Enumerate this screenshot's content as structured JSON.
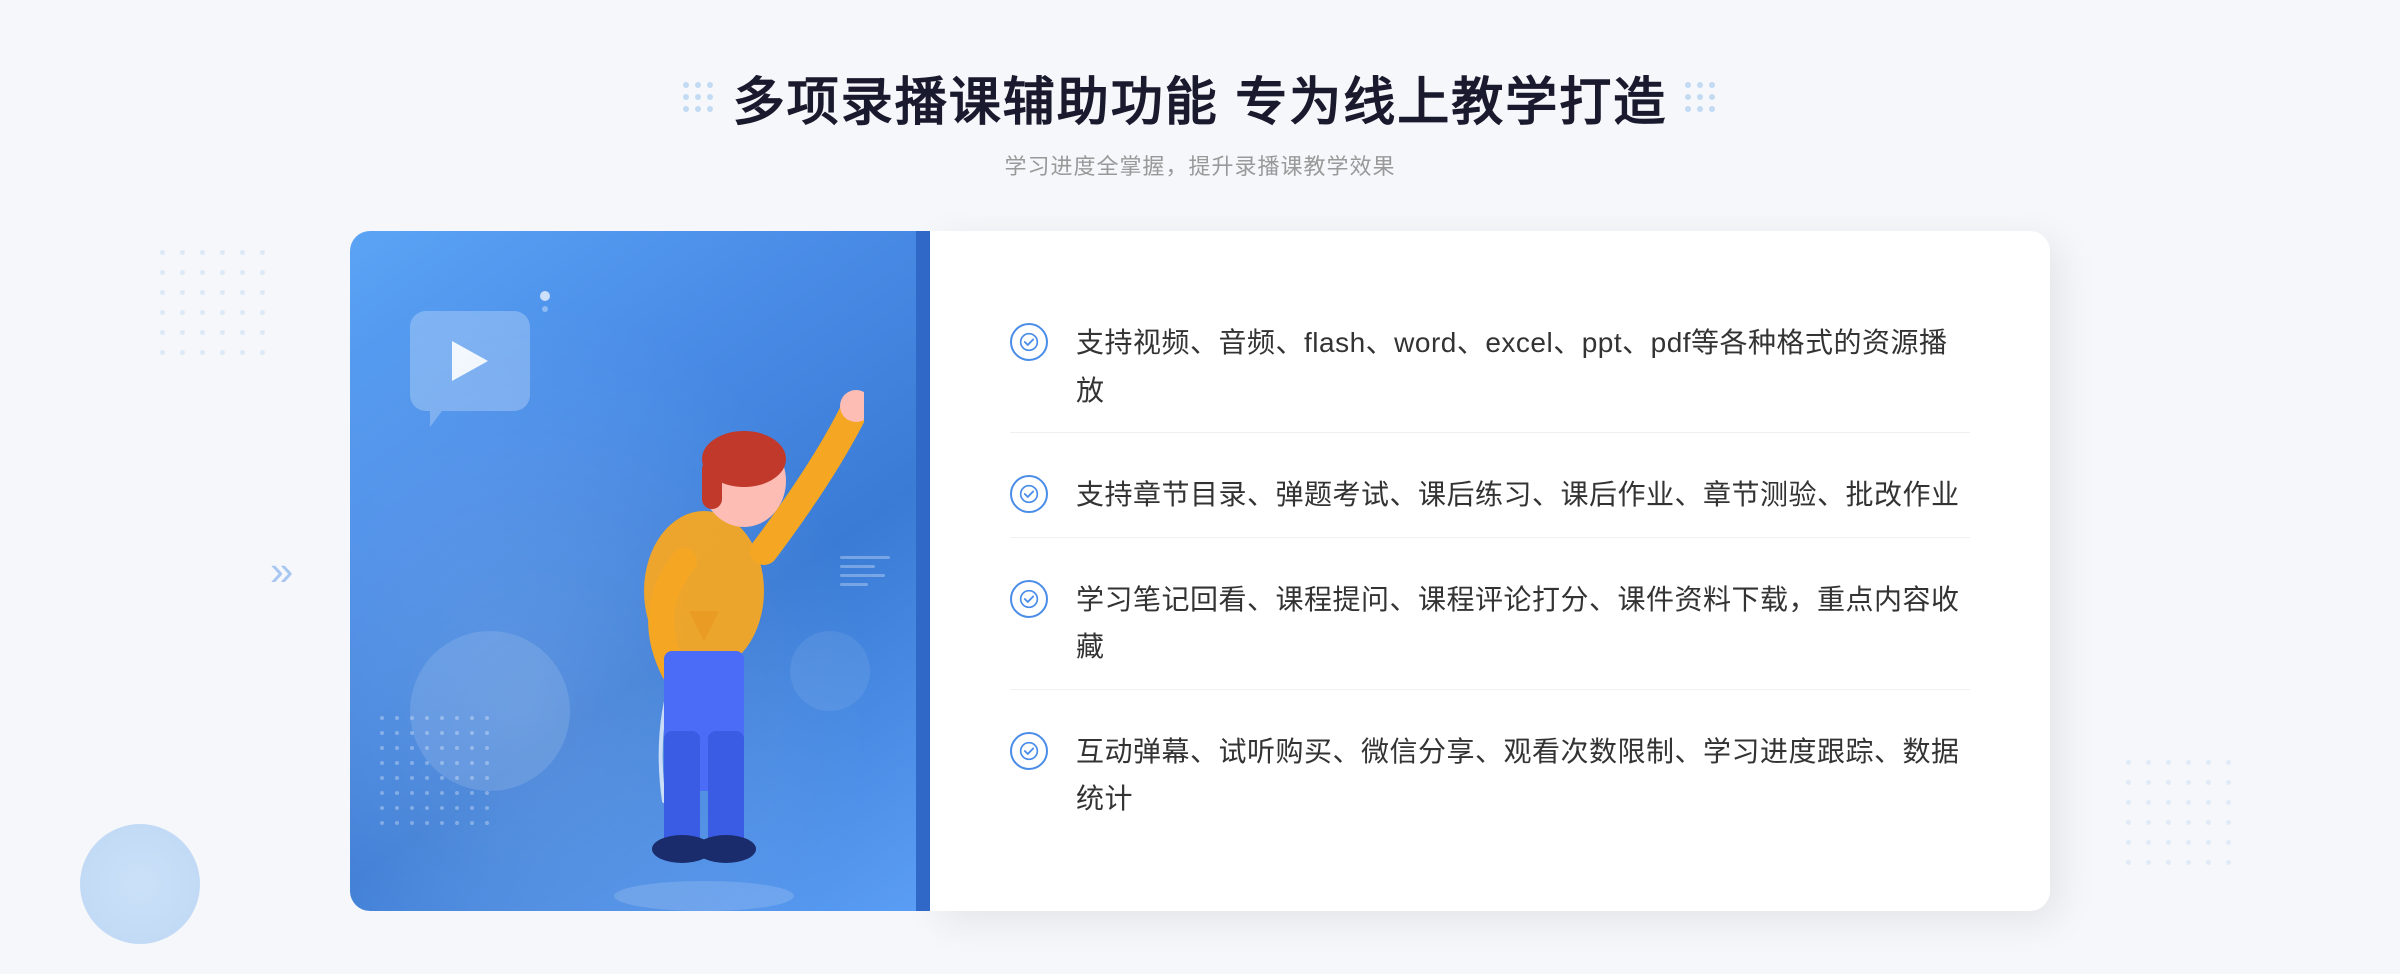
{
  "header": {
    "main_title": "多项录播课辅助功能 专为线上教学打造",
    "sub_title": "学习进度全掌握，提升录播课教学效果"
  },
  "features": [
    {
      "id": 1,
      "text": "支持视频、音频、flash、word、excel、ppt、pdf等各种格式的资源播放"
    },
    {
      "id": 2,
      "text": "支持章节目录、弹题考试、课后练习、课后作业、章节测验、批改作业"
    },
    {
      "id": 3,
      "text": "学习笔记回看、课程提问、课程评论打分、课件资料下载，重点内容收藏"
    },
    {
      "id": 4,
      "text": "互动弹幕、试听购买、微信分享、观看次数限制、学习进度跟踪、数据统计"
    }
  ],
  "illustration": {
    "play_button_alt": "play button"
  },
  "arrows": {
    "left": "»"
  }
}
